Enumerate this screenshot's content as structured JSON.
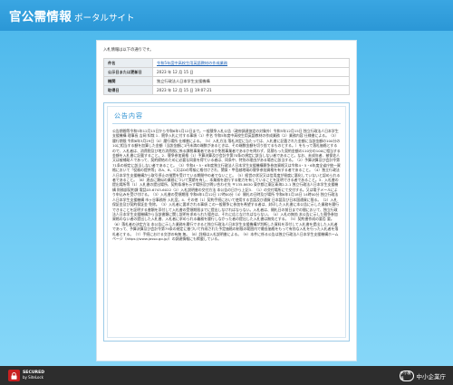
{
  "header": {
    "title": "官公需情報",
    "subtitle": "ポータルサイト"
  },
  "intro": "入札情報は以下の通りです。",
  "info_rows": [
    {
      "key": "件名",
      "value": "令和5年度中高校生用英語教材の作成業務",
      "link": true
    },
    {
      "key": "公示日または更新日",
      "value": "2023 年 12 月 15 日",
      "link": false
    },
    {
      "key": "機関",
      "value": "独立行政法人日本学生支援機構",
      "link": false
    },
    {
      "key": "取得日",
      "value": "2023 年 12 月 15 日 19:07:21",
      "link": false
    }
  ],
  "section": {
    "title": "公告内容",
    "body": "公告期間等令和5年12月15日から令和6年1月12日まで。一般競争入札公告（政府調達協定の対象外）令和5年12月15日 独立行政法人日本学生支援機構 理事長 吉岡 知哉 1．競争入札に付する事項（1）件名 令和5年度中高校生用英語教材の作成業務（2）業務内容 仕様書による。（3）履行期限 令和6年3月29日（4）履行場所 仕様書による。（5）入札方法 落札決定に当たっては、入札書に記載された金額に当該金額の100分の10に相当する額を加算した金額（当該金額に1円未満の端数があるときは、その端数金額を切り捨てるものとする。）をもって落札価格とするので、入札者は、消費税及び地方消費税に係る課税事業者であるか免税事業者であるかを問わず、見積もった契約金額の110分の100に相当する金額を入札書に記載すること。2．競争参加資格（1）予算決算及び会計令第70条の規定に該当しない者であること。なお、未成年者、被保佐人又は被補助人であって、契約締結のために必要な同意を得ている者は、同条中、特別の理由がある場合に該当する。（2）予算決算及び会計令第71条の規定に該当しない者であること。（3）令和4・5・6年度独立行政法人日本学生支援機構競争参加資格又は令和4・5・6年度全省庁統一資格において「役務の提供等」のA、B、C又はDの等級に格付けされ、関東・甲信越地域の競争参加資格を有する者であること。（4）独立行政法人日本学生支援機構から取引停止の措置を受けている期間中の者でないこと。（5）経営の状況又は信用度が極度に悪化していないと認められる者であること。（6）過去に類似の業務について実績を有し、本業務を遂行する能力を有していることを証明できる者であること。3．入札書の提出場所等（1）入札書の提出場所、契約条項を示す場所及び問い合わせ先 〒135-8630 東京都江東区青海2-2-1 独立行政法人日本学生支援機構 財務部契約課 電話03-6743-6022（2）入札説明書の交付方法 本公告の日から上記3．（1）の交付場所にて交付する。又は電子メールにより申込みを受け付ける。（3）入札書の受領期限 令和6年1月12日 17時00分（4）開札の日時及び場所 令和6年1月18日 14時00分 独立行政法人日本学生支援機構 市ヶ谷事務所 入札室。4．その他（1）契約手続において使用する言語及び通貨 日本語及び日本国通貨に限る。（2）入札保証金及び契約保証金 免除。（3）入札者に要求される事項 この一般競争に参加を希望する者は、封印した入札書に本公告に示した業務を履行できることを証明する書類を添付して入札書の受領期限までに提出しなければならない。入札者は、開札日の前日までの間において、独立行政法人日本学生支援機構から当該書類に関し説明を求められた場合は、それに応じなければならない。（4）入札の無効 本公告に示した競争参加資格のない者の提出した入札書、入札者に求められる義務を履行しなかった者の提出した入札書は無効とする。（5）契約書作成の要否 要。（6）落札者の決定方法 本公告に示した業務を履行できると独立行政法人日本学生支援機構が判断した資料を添付して入札書を提出した入札者であって、予算決算及び会計令第79条の規定に基づいて作成された予定価格の制限の範囲内で最低価格をもって有効な入札を行った入札者を落札者とする。（7）手続における交渉の有無 無。（8）詳細は入札説明書による。（9）本件に係る公告は独立行政法人日本学生支援機構ホームページ（https://www.jasso.go.jp/）の調達情報にも掲載している。"
  },
  "footer": {
    "secured_line1": "SECURED",
    "secured_line2": "by SiteLock",
    "org_badge": "中小機構",
    "org_name": "中小企業庁"
  },
  "colors": {
    "header": "#2b97d6",
    "background": "#6fcbf4",
    "accent": "#2a8fd1",
    "footer": "#2d2d2d"
  }
}
